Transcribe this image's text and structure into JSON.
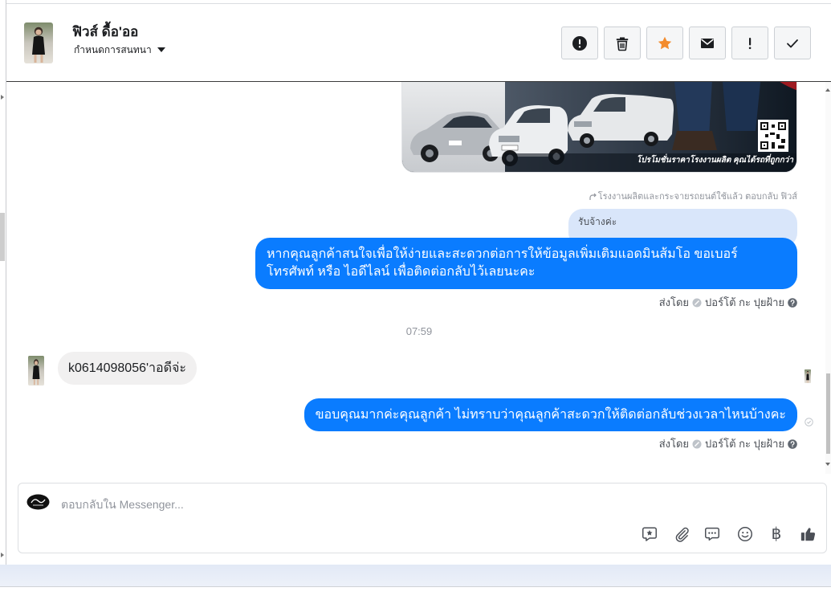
{
  "colors": {
    "accent": "#0a7cff",
    "incoming_bubble": "#f1f0f0",
    "quoted_bubble": "#d9e6fa",
    "star": "#f38b2c",
    "muted_text": "#90949c"
  },
  "header": {
    "name": "ฟิวส์ ดื้อ'ออ",
    "subtitle": "กำหนดการสนทนา",
    "actions": [
      {
        "icon": "alert-circle-icon"
      },
      {
        "icon": "trash-icon"
      },
      {
        "icon": "star-icon"
      },
      {
        "icon": "envelope-icon"
      },
      {
        "icon": "exclamation-icon"
      },
      {
        "icon": "check-icon"
      }
    ]
  },
  "thread": {
    "attachment": {
      "caption": "โปรโมชั่นราคาโรงงานผลิต คุณได้รถที่ถูกกว่า"
    },
    "reply_context": "โรงงานผลิตและกระจายรถยนต์ใช้แล้ว ตอบกลับ ฟิวส์",
    "quoted_message": "รับจ้างค่ะ",
    "outgoing_message_1": "หากคุณลูกค้าสนใจเพื่อให้ง่ายและสะดวกต่อการให้ข้อมูลเพิ่มเติมแอดมินส้มโอ ขอเบอร์ โทรศัพท์ หรือ ไอดีไลน์ เพื่อติดต่อกลับไว้เลยนะคะ",
    "sent_by": {
      "label": "ส่งโดย",
      "sender": "ปอร์โต้ กะ ปุยฝ้าย"
    },
    "timestamp": "07:59",
    "incoming_message": "k0614098056'าอดีจ่ะ",
    "outgoing_message_2": "ขอบคุณมากค่ะคุณลูกค้า ไม่ทราบว่าคุณลูกค้าสะดวกให้ติดต่อกลับช่วงเวลาไหนบ้างคะ"
  },
  "composer": {
    "placeholder": "ตอบกลับใน Messenger...",
    "tools": [
      {
        "icon": "saved-reply-icon"
      },
      {
        "icon": "paperclip-icon"
      },
      {
        "icon": "chat-dots-icon"
      },
      {
        "icon": "emoji-icon"
      },
      {
        "icon": "baht-icon",
        "glyph": "฿"
      },
      {
        "icon": "thumbs-up-icon"
      }
    ]
  }
}
